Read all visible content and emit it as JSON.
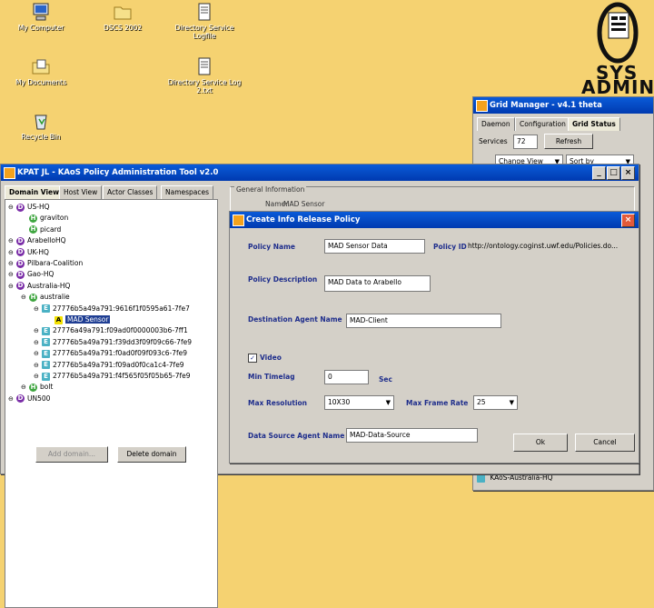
{
  "desktop": {
    "icons": [
      {
        "label": "My Computer",
        "icon": "computer-icon"
      },
      {
        "label": "DSCS 2002",
        "icon": "folder-icon"
      },
      {
        "label": "Directory Service Logfile",
        "icon": "document-icon"
      },
      {
        "label": "My Documents",
        "icon": "my-documents-icon"
      },
      {
        "label": "Directory Service Log 2.txt",
        "icon": "document-icon"
      },
      {
        "label": "Recycle Bin",
        "icon": "recycle-bin-icon"
      }
    ],
    "logo": {
      "line1": "SYS",
      "line2": "ADMIN"
    }
  },
  "grid_manager": {
    "title": "Grid Manager - v4.1 theta",
    "tabs": [
      "Daemon",
      "Configuration",
      "Grid Status"
    ],
    "services_label": "Services",
    "services_value": "72",
    "refresh_label": "Refresh",
    "change_view_label": "Change View",
    "sort_by_label": "Sort by",
    "footer_item": "KAoS-Australia-HQ"
  },
  "kpat": {
    "title": "KPAT JL - KAoS Policy Administration Tool v2.0",
    "tabs": [
      "Domain View",
      "Host View",
      "Actor Classes",
      "Namespaces"
    ],
    "tree": [
      {
        "badge": "D",
        "label": "US-HQ",
        "level": 0,
        "expander": "−"
      },
      {
        "badge": "H",
        "label": "graviton",
        "level": 1,
        "expander": ""
      },
      {
        "badge": "H",
        "label": "picard",
        "level": 1,
        "expander": ""
      },
      {
        "badge": "D",
        "label": "ArabelloHQ",
        "level": 0,
        "expander": "−"
      },
      {
        "badge": "D",
        "label": "UK-HQ",
        "level": 0,
        "expander": "−"
      },
      {
        "badge": "D",
        "label": "Pilbara-Coalition",
        "level": 0,
        "expander": "−"
      },
      {
        "badge": "D",
        "label": "Gao-HQ",
        "level": 0,
        "expander": "−"
      },
      {
        "badge": "D",
        "label": "Australia-HQ",
        "level": 0,
        "expander": "−"
      },
      {
        "badge": "H",
        "label": "australie",
        "level": 1,
        "expander": "−"
      },
      {
        "badge": "E",
        "label": "27776b5a49a791:9616f1f0595a61-7fe7",
        "level": 2,
        "expander": "−"
      },
      {
        "badge": "A",
        "label": "MAD Sensor",
        "level": 3,
        "expander": "",
        "selected": true
      },
      {
        "badge": "E",
        "label": "27776a49a791:f09ad0f0000003b6-7ff1",
        "level": 2,
        "expander": "−"
      },
      {
        "badge": "E",
        "label": "27776b5a49a791:f39dd3f09f09c66-7fe9",
        "level": 2,
        "expander": "−"
      },
      {
        "badge": "E",
        "label": "27776b5a49a791:f0ad0f09f093c6-7fe9",
        "level": 2,
        "expander": "−"
      },
      {
        "badge": "E",
        "label": "27776b5a49a791:f09ad0f0ca1c4-7fe9",
        "level": 2,
        "expander": "−"
      },
      {
        "badge": "E",
        "label": "27776b5a49a791:f4f565f05f05b65-7fe9",
        "level": 2,
        "expander": "−"
      },
      {
        "badge": "H",
        "label": "bolt",
        "level": 1,
        "expander": "−"
      },
      {
        "badge": "D",
        "label": "UN500",
        "level": 0,
        "expander": "−"
      }
    ],
    "add_domain_label": "Add domain...",
    "delete_domain_label": "Delete domain",
    "general_info_label": "General Information",
    "name_label": "Name:",
    "name_value": "MAD Sensor"
  },
  "dialog": {
    "title": "Create Info Release Policy",
    "policy_name_label": "Policy Name",
    "policy_name_value": "MAD Sensor Data",
    "policy_id_label": "Policy ID",
    "policy_id_value": "http://ontology.coginst.uwf.edu/Policies.do...",
    "policy_description_label": "Policy Description",
    "policy_description_value": "MAD Data to Arabello",
    "destination_agent_label": "Destination Agent Name",
    "destination_agent_value": "MAD-Client",
    "video_label": "Video",
    "video_checked": "✓",
    "min_timelag_label": "Min Timelag",
    "min_timelag_value": "0",
    "sec_label": "Sec",
    "max_resolution_label": "Max Resolution",
    "max_resolution_value": "10X30",
    "max_frame_rate_label": "Max Frame Rate",
    "max_frame_rate_value": "25",
    "data_source_label": "Data Source Agent Name",
    "data_source_value": "MAD-Data-Source",
    "ok_label": "Ok",
    "cancel_label": "Cancel"
  }
}
